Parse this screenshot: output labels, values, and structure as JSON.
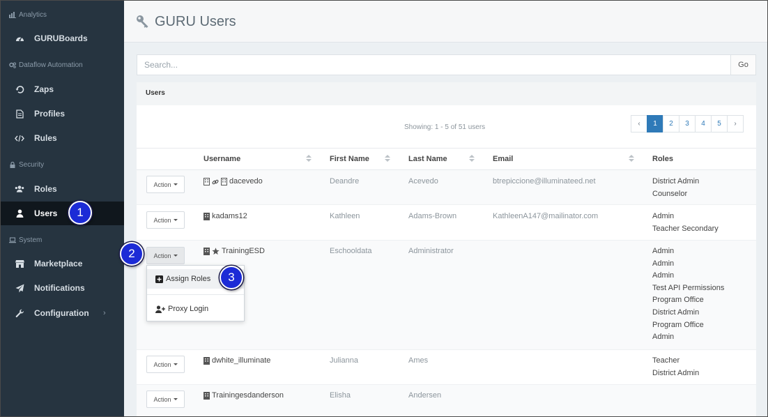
{
  "sidebar": {
    "sections": {
      "analytics": "Analytics",
      "dataflow": "Dataflow Automation",
      "security": "Security",
      "system": "System"
    },
    "items": {
      "guruboards": "GURUBoards",
      "zaps": "Zaps",
      "profiles": "Profiles",
      "rules": "Rules",
      "roles": "Roles",
      "users": "Users",
      "marketplace": "Marketplace",
      "notifications": "Notifications",
      "configuration": "Configuration"
    },
    "configuration_chevron": "›"
  },
  "header": {
    "title": "GURU Users"
  },
  "search": {
    "placeholder": "Search...",
    "go_label": "Go"
  },
  "panel": {
    "title": "Users",
    "showing": "Showing: 1 - 5 of 51 users",
    "pagination": {
      "prev": "‹",
      "pages": [
        "1",
        "2",
        "3",
        "4",
        "5"
      ],
      "next": "›",
      "active": "1"
    }
  },
  "table": {
    "columns": {
      "username": "Username",
      "first_name": "First Name",
      "last_name": "Last Name",
      "email": "Email",
      "roles": "Roles"
    },
    "action_label": "Action",
    "rows": [
      {
        "username": "dacevedo",
        "first_name": "Deandre",
        "last_name": "Acevedo",
        "email": "btrepiccione@illuminateed.net",
        "roles": [
          "District Admin",
          "Counselor"
        ]
      },
      {
        "username": "kadams12",
        "first_name": "Kathleen",
        "last_name": "Adams-Brown",
        "email": "KathleenA147@mailinator.com",
        "roles": [
          "Admin",
          "Teacher Secondary"
        ]
      },
      {
        "username": "TrainingESD",
        "first_name": "Eschooldata",
        "last_name": "Administrator",
        "email": "",
        "roles": [
          "Admin",
          "Admin",
          "Admin",
          "Test API Permissions",
          "Program Office",
          "District Admin",
          "Program Office",
          "Admin"
        ]
      },
      {
        "username": "dwhite_illuminate",
        "first_name": "Julianna",
        "last_name": "Ames",
        "email": "",
        "roles": [
          "Teacher",
          "District Admin"
        ]
      },
      {
        "username": "Trainingesdanderson",
        "first_name": "Elisha",
        "last_name": "Andersen",
        "email": "",
        "roles": []
      }
    ]
  },
  "dropdown": {
    "assign_roles": "Assign Roles",
    "proxy_login": "Proxy Login"
  },
  "callouts": {
    "one": "1",
    "two": "2",
    "three": "3"
  },
  "colors": {
    "sidebar_bg": "#263440",
    "accent": "#2f7ab8",
    "callout": "#1c2bd6"
  }
}
